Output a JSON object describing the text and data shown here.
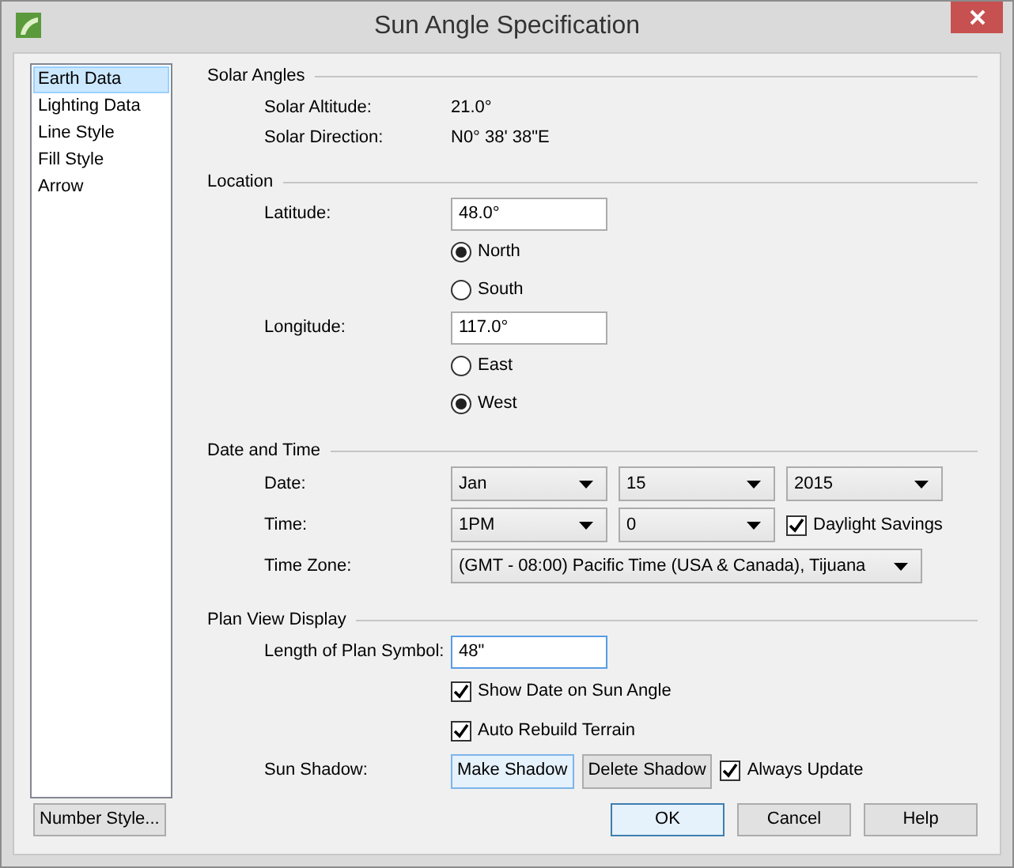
{
  "window": {
    "title": "Sun Angle Specification"
  },
  "sidebar": {
    "items": [
      {
        "label": "Earth Data",
        "selected": true
      },
      {
        "label": "Lighting Data",
        "selected": false
      },
      {
        "label": "Line Style",
        "selected": false
      },
      {
        "label": "Fill Style",
        "selected": false
      },
      {
        "label": "Arrow",
        "selected": false
      }
    ]
  },
  "sections": [
    {
      "title": "Solar Angles",
      "rows": [
        {
          "label": "Solar Altitude:",
          "controls": [
            {
              "kind": "text",
              "value": "21.0°"
            }
          ]
        },
        {
          "label": "Solar Direction:",
          "controls": [
            {
              "kind": "text",
              "value": "N0° 38' 38\"E"
            }
          ]
        }
      ]
    },
    {
      "title": "Location",
      "rows": [
        {
          "label": "Latitude:",
          "controls": [
            {
              "kind": "input",
              "value": "48.0°",
              "focused": false
            }
          ]
        },
        {
          "controls": [
            {
              "kind": "radio",
              "label": "North",
              "selected": true
            }
          ]
        },
        {
          "controls": [
            {
              "kind": "radio",
              "label": "South",
              "selected": false
            }
          ]
        },
        {
          "label": "Longitude:",
          "controls": [
            {
              "kind": "input",
              "value": "117.0°",
              "focused": false
            }
          ]
        },
        {
          "controls": [
            {
              "kind": "radio",
              "label": "East",
              "selected": false
            }
          ]
        },
        {
          "controls": [
            {
              "kind": "radio",
              "label": "West",
              "selected": true
            }
          ]
        }
      ]
    },
    {
      "title": "Date and Time",
      "rows": [
        {
          "label": "Date:",
          "controls": [
            {
              "kind": "select",
              "value": "Jan"
            },
            {
              "kind": "select",
              "value": "15"
            },
            {
              "kind": "select",
              "value": "2015"
            }
          ]
        },
        {
          "label": "Time:",
          "controls": [
            {
              "kind": "select",
              "value": "1PM"
            },
            {
              "kind": "select",
              "value": "0"
            },
            {
              "kind": "checkbox",
              "label": "Daylight Savings",
              "checked": true
            }
          ]
        },
        {
          "label": "Time Zone:",
          "controls": [
            {
              "kind": "wide_select",
              "value": "(GMT - 08:00) Pacific Time (USA & Canada), Tijuana"
            }
          ]
        }
      ]
    },
    {
      "title": "Plan View Display",
      "rows": [
        {
          "label": "Length of Plan Symbol:",
          "controls": [
            {
              "kind": "input",
              "value": "48\"",
              "focused": true
            }
          ]
        },
        {
          "controls": [
            {
              "kind": "checkbox",
              "label": "Show Date on Sun Angle",
              "checked": true
            }
          ]
        },
        {
          "controls": [
            {
              "kind": "checkbox",
              "label": "Auto Rebuild Terrain",
              "checked": true
            }
          ]
        },
        {
          "label": "Sun Shadow:",
          "controls": [
            {
              "kind": "button",
              "label": "Make Shadow",
              "highlighted": true
            },
            {
              "kind": "button",
              "label": "Delete Shadow",
              "highlighted": false
            },
            {
              "kind": "checkbox",
              "label": "Always Update",
              "checked": true
            }
          ]
        }
      ]
    }
  ],
  "number_style_button": "Number Style...",
  "buttons": [
    {
      "label": "OK",
      "highlighted": true
    },
    {
      "label": "Cancel",
      "highlighted": false
    },
    {
      "label": "Help",
      "highlighted": false
    }
  ]
}
